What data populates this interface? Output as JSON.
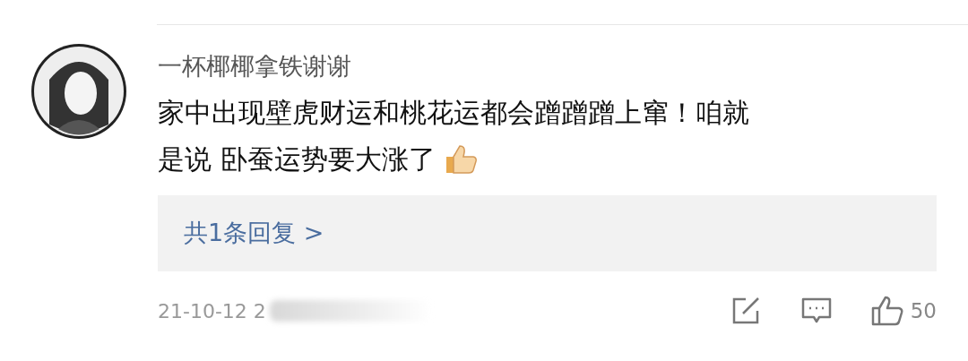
{
  "comment": {
    "username": "一杯椰椰拿铁谢谢",
    "lines": [
      "家中出现壁虎财运和桃花运都会蹭蹭蹭上窜！咱就",
      "是说 卧蚕运势要大涨了"
    ],
    "reply_link": "共1条回复 >",
    "date": "21-10-12 2",
    "like_count": "50"
  }
}
